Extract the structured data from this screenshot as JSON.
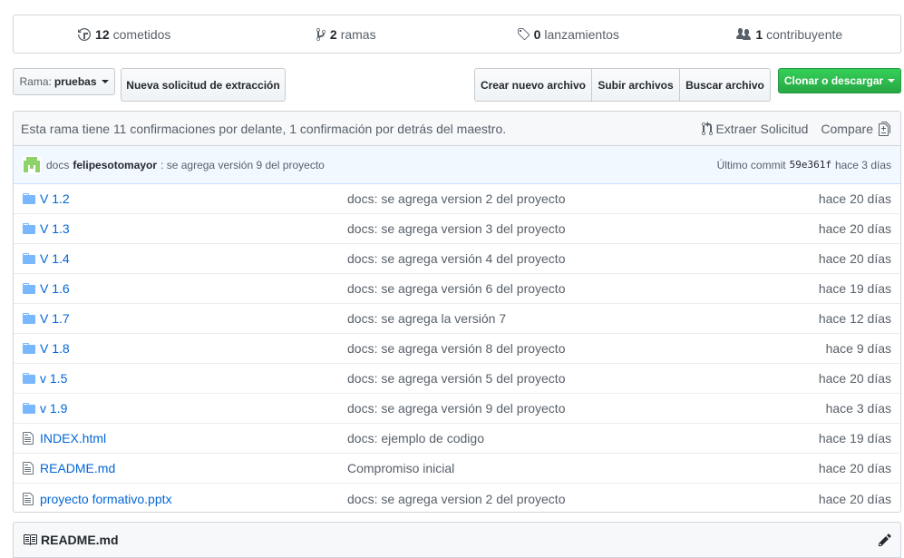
{
  "numbers": {
    "commits": {
      "count": "12",
      "label": "cometidos",
      "icon": "history-icon"
    },
    "branches": {
      "count": "2",
      "label": "ramas",
      "icon": "branch-icon"
    },
    "releases": {
      "count": "0",
      "label": "lanzamientos",
      "icon": "tag-icon"
    },
    "contributors": {
      "count": "1",
      "label": "contribuyente",
      "icon": "people-icon"
    }
  },
  "toolbar": {
    "branch_prefix": "Rama:",
    "branch_name": "pruebas",
    "new_pr": "Nueva solicitud de extracción",
    "create_file": "Crear nuevo archivo",
    "upload_files": "Subir archivos",
    "find_file": "Buscar archivo",
    "clone": "Clonar o descargar"
  },
  "branch_info": {
    "text": "Esta rama tiene 11 confirmaciones por delante, 1 confirmación por detrás del maestro.",
    "pull_request": "Extraer Solicitud",
    "compare": "Compare"
  },
  "last_commit": {
    "prefix": "docs",
    "author": "felipesotomayor",
    "message": ": se agrega versión 9 del proyecto",
    "latest_label": "Último commit",
    "sha": "59e361f",
    "age": "hace 3 días"
  },
  "files": [
    {
      "type": "dir",
      "name": "V 1.2",
      "message": "docs: se agrega version 2 del proyecto",
      "age": "hace 20 días"
    },
    {
      "type": "dir",
      "name": "V 1.3",
      "message": "docs: se agrega version 3 del proyecto",
      "age": "hace 20 días"
    },
    {
      "type": "dir",
      "name": "V 1.4",
      "message": "docs: se agrega versión 4 del proyecto",
      "age": "hace 20 días"
    },
    {
      "type": "dir",
      "name": "V 1.6",
      "message": "docs: se agrega versión 6 del proyecto",
      "age": "hace 19 días"
    },
    {
      "type": "dir",
      "name": "V 1.7",
      "message": "docs: se agrega la versión 7",
      "age": "hace 12 días"
    },
    {
      "type": "dir",
      "name": "V 1.8",
      "message": "docs: se agrega versión 8 del proyecto",
      "age": "hace 9 días"
    },
    {
      "type": "dir",
      "name": "v 1.5",
      "message": "docs: se agrega versión 5 del proyecto",
      "age": "hace 20 días"
    },
    {
      "type": "dir",
      "name": "v 1.9",
      "message": "docs: se agrega versión 9 del proyecto",
      "age": "hace 3 días"
    },
    {
      "type": "file",
      "name": "INDEX.html",
      "message": "docs: ejemplo de codigo",
      "age": "hace 19 días"
    },
    {
      "type": "file",
      "name": "README.md",
      "message": "Compromiso inicial",
      "age": "hace 20 días"
    },
    {
      "type": "file",
      "name": "proyecto formativo.pptx",
      "message": "docs: se agrega version 2 del proyecto",
      "age": "hace 20 días"
    }
  ],
  "readme": {
    "title": "README.md",
    "icon": "book-icon",
    "edit_icon": "pencil-icon"
  },
  "colors": {
    "link": "#0366d6",
    "green": "#28a745",
    "folder": "#79b8ff"
  }
}
